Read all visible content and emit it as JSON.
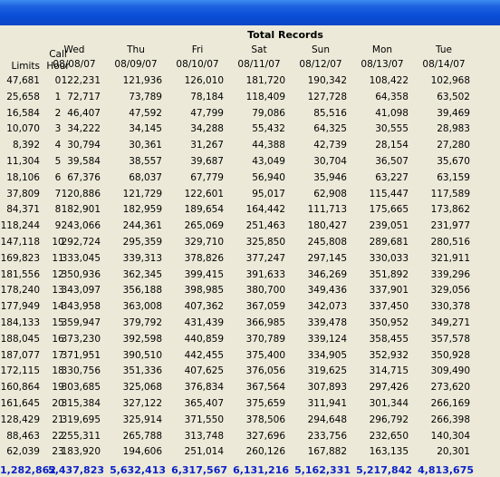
{
  "window": {
    "title_bar_color": "#1f63e0"
  },
  "header": {
    "total_records_label": "Total Records",
    "limits_label": "Limits",
    "call_label": "Call",
    "hour_label": "Hour",
    "days": [
      {
        "day": "Wed",
        "date": "08/08/07"
      },
      {
        "day": "Thu",
        "date": "08/09/07"
      },
      {
        "day": "Fri",
        "date": "08/10/07"
      },
      {
        "day": "Sat",
        "date": "08/11/07"
      },
      {
        "day": "Sun",
        "date": "08/12/07"
      },
      {
        "day": "Mon",
        "date": "08/13/07"
      },
      {
        "day": "Tue",
        "date": "08/14/07"
      }
    ]
  },
  "rows": [
    {
      "limit": "47,681",
      "hour": "0",
      "values": [
        "122,231",
        "121,936",
        "126,010",
        "181,720",
        "190,342",
        "108,422",
        "102,968"
      ]
    },
    {
      "limit": "25,658",
      "hour": "1",
      "values": [
        "72,717",
        "73,789",
        "78,184",
        "118,409",
        "127,728",
        "64,358",
        "63,502"
      ]
    },
    {
      "limit": "16,584",
      "hour": "2",
      "values": [
        "46,407",
        "47,592",
        "47,799",
        "79,086",
        "85,516",
        "41,098",
        "39,469"
      ]
    },
    {
      "limit": "10,070",
      "hour": "3",
      "values": [
        "34,222",
        "34,145",
        "34,288",
        "55,432",
        "64,325",
        "30,555",
        "28,983"
      ]
    },
    {
      "limit": "8,392",
      "hour": "4",
      "values": [
        "30,794",
        "30,361",
        "31,267",
        "44,388",
        "42,739",
        "28,154",
        "27,280"
      ]
    },
    {
      "limit": "11,304",
      "hour": "5",
      "values": [
        "39,584",
        "38,557",
        "39,687",
        "43,049",
        "30,704",
        "36,507",
        "35,670"
      ]
    },
    {
      "limit": "18,106",
      "hour": "6",
      "values": [
        "67,376",
        "68,037",
        "67,779",
        "56,940",
        "35,946",
        "63,227",
        "63,159"
      ]
    },
    {
      "limit": "37,809",
      "hour": "7",
      "values": [
        "120,886",
        "121,729",
        "122,601",
        "95,017",
        "62,908",
        "115,447",
        "117,589"
      ]
    },
    {
      "limit": "84,371",
      "hour": "8",
      "values": [
        "182,901",
        "182,959",
        "189,654",
        "164,442",
        "111,713",
        "175,665",
        "173,862"
      ]
    },
    {
      "limit": "118,244",
      "hour": "9",
      "values": [
        "243,066",
        "244,361",
        "265,069",
        "251,463",
        "180,427",
        "239,051",
        "231,977"
      ]
    },
    {
      "limit": "147,118",
      "hour": "10",
      "values": [
        "292,724",
        "295,359",
        "329,710",
        "325,850",
        "245,808",
        "289,681",
        "280,516"
      ]
    },
    {
      "limit": "169,823",
      "hour": "11",
      "values": [
        "333,045",
        "339,313",
        "378,826",
        "377,247",
        "297,145",
        "330,033",
        "321,911"
      ]
    },
    {
      "limit": "181,556",
      "hour": "12",
      "values": [
        "350,936",
        "362,345",
        "399,415",
        "391,633",
        "346,269",
        "351,892",
        "339,296"
      ]
    },
    {
      "limit": "178,240",
      "hour": "13",
      "values": [
        "343,097",
        "356,188",
        "398,985",
        "380,700",
        "349,436",
        "337,901",
        "329,056"
      ]
    },
    {
      "limit": "177,949",
      "hour": "14",
      "values": [
        "343,958",
        "363,008",
        "407,362",
        "367,059",
        "342,073",
        "337,450",
        "330,378"
      ]
    },
    {
      "limit": "184,133",
      "hour": "15",
      "values": [
        "359,947",
        "379,792",
        "431,439",
        "366,985",
        "339,478",
        "350,952",
        "349,271"
      ]
    },
    {
      "limit": "188,045",
      "hour": "16",
      "values": [
        "373,230",
        "392,598",
        "440,859",
        "370,789",
        "339,124",
        "358,455",
        "357,578"
      ]
    },
    {
      "limit": "187,077",
      "hour": "17",
      "values": [
        "371,951",
        "390,510",
        "442,455",
        "375,400",
        "334,905",
        "352,932",
        "350,928"
      ]
    },
    {
      "limit": "172,115",
      "hour": "18",
      "values": [
        "330,756",
        "351,336",
        "407,625",
        "376,056",
        "319,625",
        "314,715",
        "309,490"
      ]
    },
    {
      "limit": "160,864",
      "hour": "19",
      "values": [
        "303,685",
        "325,068",
        "376,834",
        "367,564",
        "307,893",
        "297,426",
        "273,620"
      ]
    },
    {
      "limit": "161,645",
      "hour": "20",
      "values": [
        "315,384",
        "327,122",
        "365,407",
        "375,659",
        "311,941",
        "301,344",
        "266,169"
      ]
    },
    {
      "limit": "128,429",
      "hour": "21",
      "values": [
        "319,695",
        "325,914",
        "371,550",
        "378,506",
        "294,648",
        "296,792",
        "266,398"
      ]
    },
    {
      "limit": "88,463",
      "hour": "22",
      "values": [
        "255,311",
        "265,788",
        "313,748",
        "327,696",
        "233,756",
        "232,650",
        "140,304"
      ]
    },
    {
      "limit": "62,039",
      "hour": "23",
      "values": [
        "183,920",
        "194,606",
        "251,014",
        "260,126",
        "167,882",
        "163,135",
        "20,301"
      ]
    }
  ],
  "totals": {
    "limit": "1,282,862",
    "values": [
      "5,437,823",
      "5,632,413",
      "6,317,567",
      "6,131,216",
      "5,162,331",
      "5,217,842",
      "4,813,675"
    ]
  },
  "colors": {
    "totals_text": "#0b22c8",
    "background": "#ece9d8"
  }
}
